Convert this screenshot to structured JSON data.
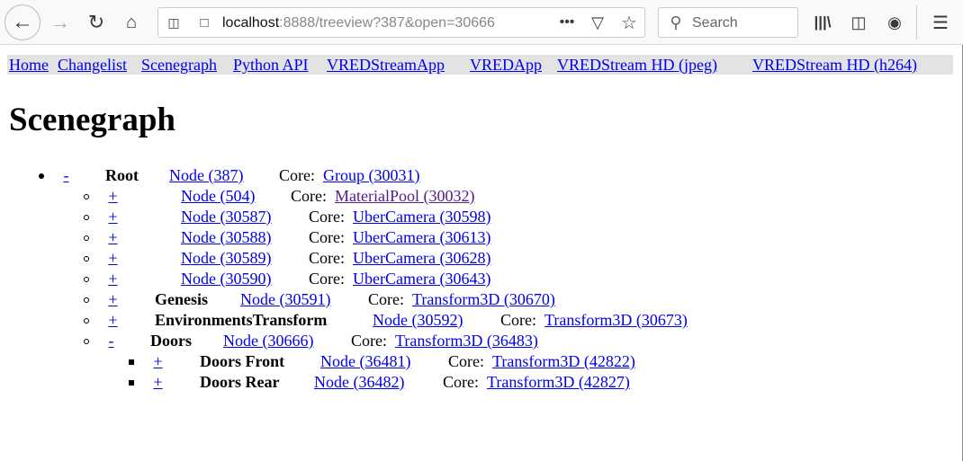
{
  "browser": {
    "url_host": "localhost",
    "url_rest": ":8888/treeview?387&open=30666",
    "search_placeholder": "Search"
  },
  "nav": [
    "Home",
    "Changelist",
    "Scenegraph",
    "Python API",
    "VREDStreamApp",
    "VREDApp",
    "VREDStream HD (jpeg)",
    "VREDStream HD (h264)"
  ],
  "title": "Scenegraph",
  "core_label": "Core:",
  "rows": [
    {
      "toggle": "-",
      "name": "Root",
      "node": "Node (387)",
      "core": "Group (30031)"
    },
    {
      "toggle": "+",
      "name": "",
      "node": "Node (504)",
      "core": "MaterialPool (30032)"
    },
    {
      "toggle": "+",
      "name": "",
      "node": "Node (30587)",
      "core": "UberCamera (30598)"
    },
    {
      "toggle": "+",
      "name": "",
      "node": "Node (30588)",
      "core": "UberCamera (30613)"
    },
    {
      "toggle": "+",
      "name": "",
      "node": "Node (30589)",
      "core": "UberCamera (30628)"
    },
    {
      "toggle": "+",
      "name": "",
      "node": "Node (30590)",
      "core": "UberCamera (30643)"
    },
    {
      "toggle": "+",
      "name": "Genesis",
      "node": "Node (30591)",
      "core": "Transform3D (30670)"
    },
    {
      "toggle": "+",
      "name": "EnvironmentsTransform",
      "node": "Node (30592)",
      "core": "Transform3D (30673)"
    },
    {
      "toggle": "-",
      "name": "Doors",
      "node": "Node (30666)",
      "core": "Transform3D (36483)"
    },
    {
      "toggle": "+",
      "name": "Doors Front",
      "node": "Node (36481)",
      "core": "Transform3D (42822)"
    },
    {
      "toggle": "+",
      "name": "Doors Rear",
      "node": "Node (36482)",
      "core": "Transform3D (42827)"
    }
  ]
}
